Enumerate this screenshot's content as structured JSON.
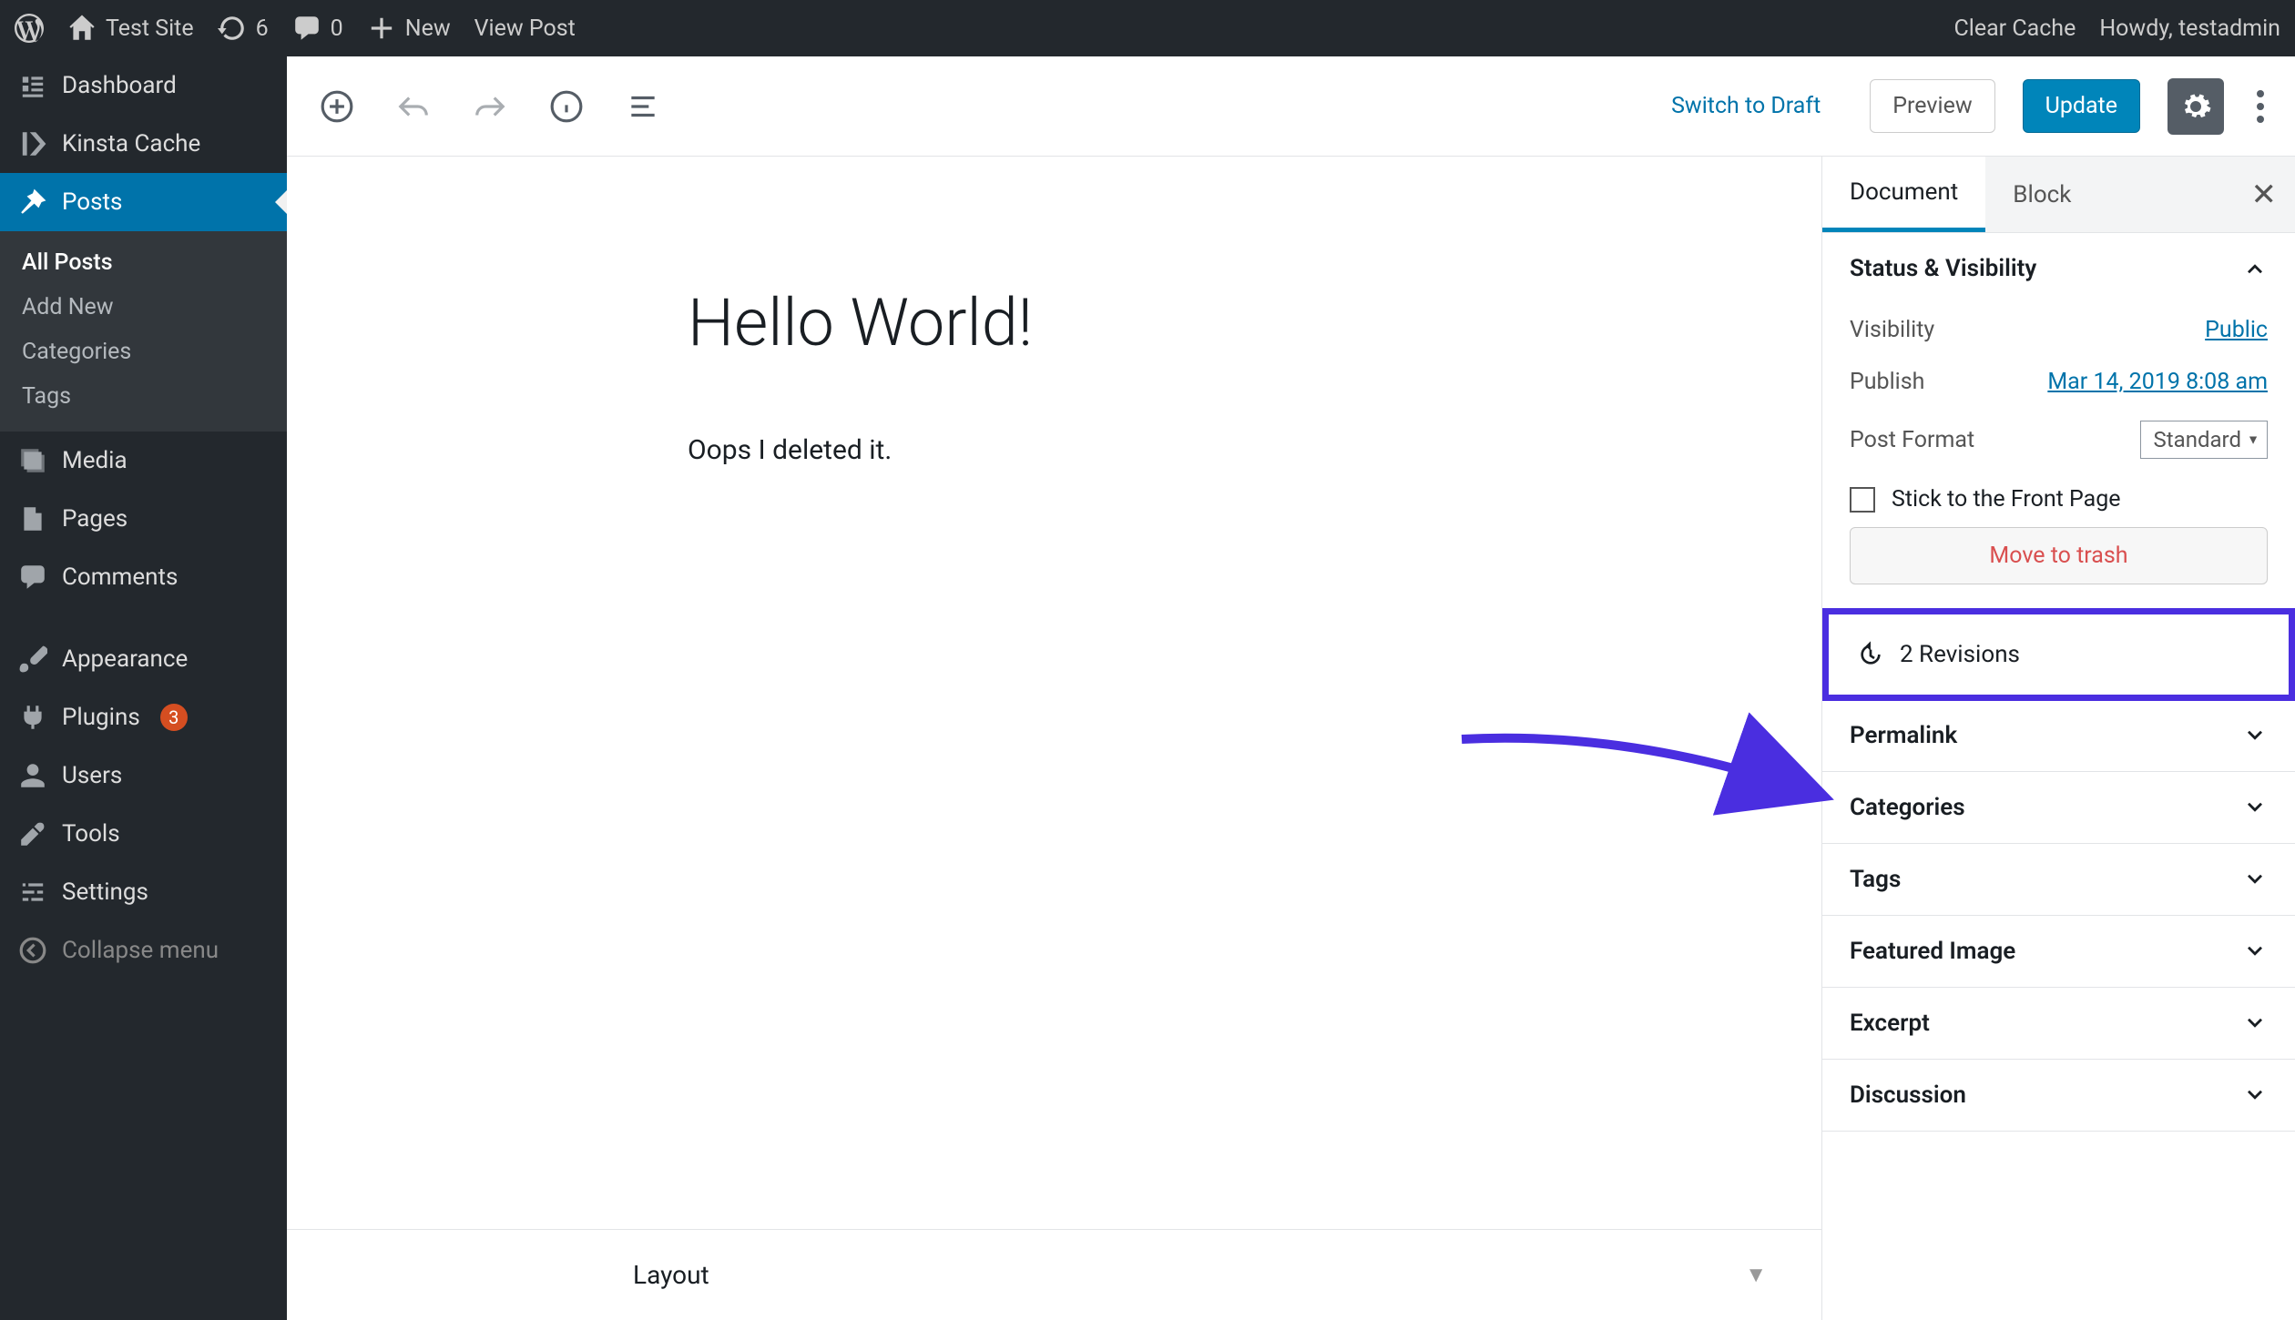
{
  "adminbar": {
    "site": "Test Site",
    "updates": "6",
    "comments": "0",
    "new": "New",
    "view": "View Post",
    "clear": "Clear Cache",
    "howdy": "Howdy, testadmin"
  },
  "sidebar": {
    "dashboard": "Dashboard",
    "kinsta": "Kinsta Cache",
    "posts": "Posts",
    "sub": {
      "all": "All Posts",
      "add": "Add New",
      "cat": "Categories",
      "tags": "Tags"
    },
    "media": "Media",
    "pages": "Pages",
    "comments": "Comments",
    "appearance": "Appearance",
    "plugins": "Plugins",
    "plugins_badge": "3",
    "users": "Users",
    "tools": "Tools",
    "settings": "Settings",
    "collapse": "Collapse menu"
  },
  "editor": {
    "switch": "Switch to Draft",
    "preview": "Preview",
    "update": "Update"
  },
  "post": {
    "title": "Hello World!",
    "body": "Oops I deleted it."
  },
  "layoutbar": {
    "label": "Layout"
  },
  "tabs": {
    "doc": "Document",
    "block": "Block"
  },
  "status": {
    "header": "Status & Visibility",
    "vis_label": "Visibility",
    "vis_value": "Public",
    "pub_label": "Publish",
    "pub_value": "Mar 14, 2019 8:08 am",
    "fmt_label": "Post Format",
    "fmt_value": "Standard",
    "stick": "Stick to the Front Page",
    "trash": "Move to trash"
  },
  "revisions": {
    "label": "2 Revisions"
  },
  "sections": {
    "permalink": "Permalink",
    "categories": "Categories",
    "tags": "Tags",
    "featured": "Featured Image",
    "excerpt": "Excerpt",
    "discussion": "Discussion"
  }
}
